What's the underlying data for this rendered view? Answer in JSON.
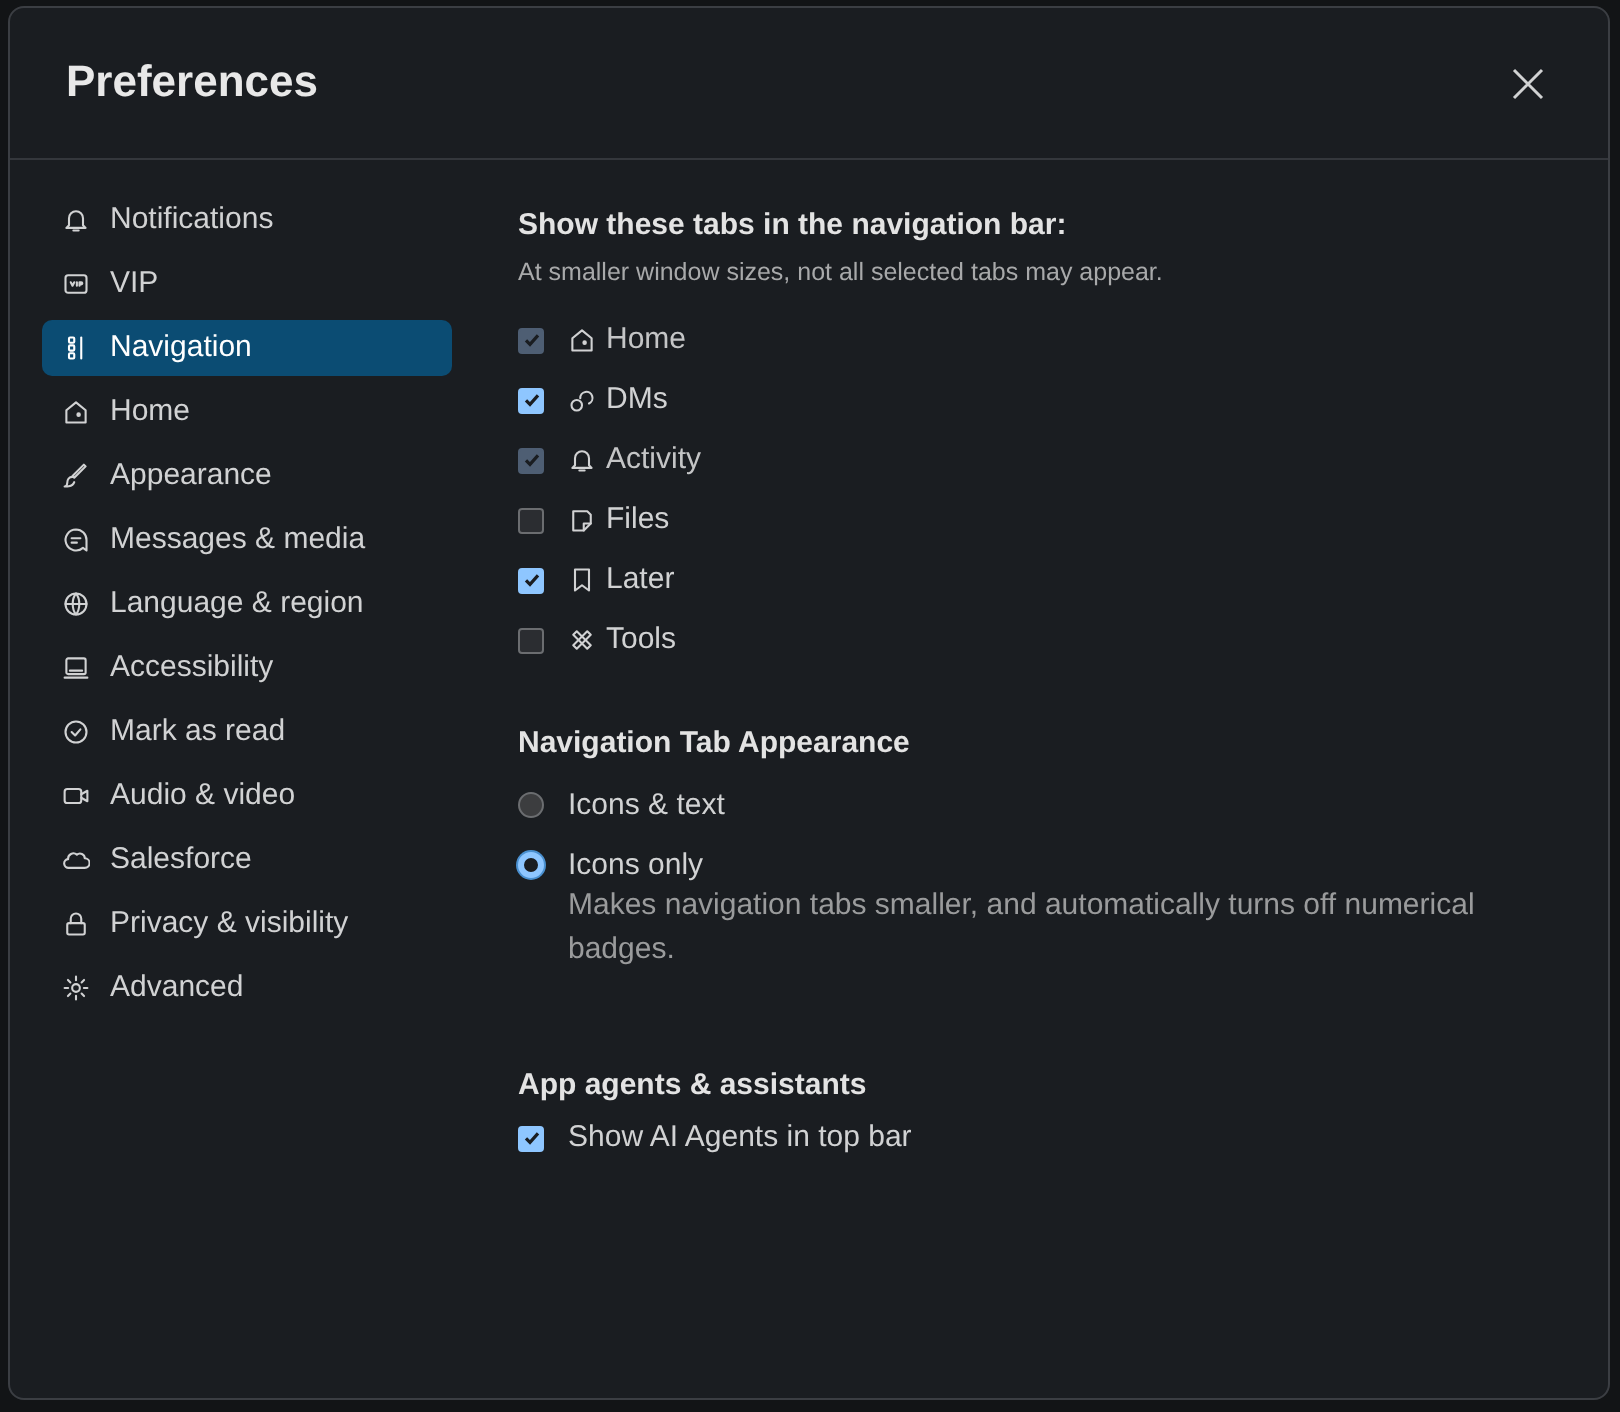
{
  "dialog": {
    "title": "Preferences"
  },
  "sidebar": {
    "items": [
      {
        "label": "Notifications",
        "selected": false
      },
      {
        "label": "VIP",
        "selected": false
      },
      {
        "label": "Navigation",
        "selected": true
      },
      {
        "label": "Home",
        "selected": false
      },
      {
        "label": "Appearance",
        "selected": false
      },
      {
        "label": "Messages & media",
        "selected": false
      },
      {
        "label": "Language & region",
        "selected": false
      },
      {
        "label": "Accessibility",
        "selected": false
      },
      {
        "label": "Mark as read",
        "selected": false
      },
      {
        "label": "Audio & video",
        "selected": false
      },
      {
        "label": "Salesforce",
        "selected": false
      },
      {
        "label": "Privacy & visibility",
        "selected": false
      },
      {
        "label": "Advanced",
        "selected": false
      }
    ]
  },
  "tabs_section": {
    "heading": "Show these tabs in the navigation bar:",
    "hint": "At smaller window sizes, not all selected tabs may appear.",
    "options": [
      {
        "label": "Home",
        "checked": true,
        "disabled": true
      },
      {
        "label": "DMs",
        "checked": true,
        "disabled": false
      },
      {
        "label": "Activity",
        "checked": true,
        "disabled": true
      },
      {
        "label": "Files",
        "checked": false,
        "disabled": false
      },
      {
        "label": "Later",
        "checked": true,
        "disabled": false
      },
      {
        "label": "Tools",
        "checked": false,
        "disabled": false
      }
    ]
  },
  "appearance_section": {
    "heading": "Navigation Tab Appearance",
    "options": [
      {
        "label": "Icons & text",
        "selected": false
      },
      {
        "label": "Icons only",
        "selected": true,
        "description": "Makes navigation tabs smaller, and automatically turns off numerical badges."
      }
    ]
  },
  "agents_section": {
    "heading": "App agents & assistants",
    "options": [
      {
        "label": "Show AI Agents in top bar",
        "checked": true,
        "disabled": false
      }
    ]
  }
}
